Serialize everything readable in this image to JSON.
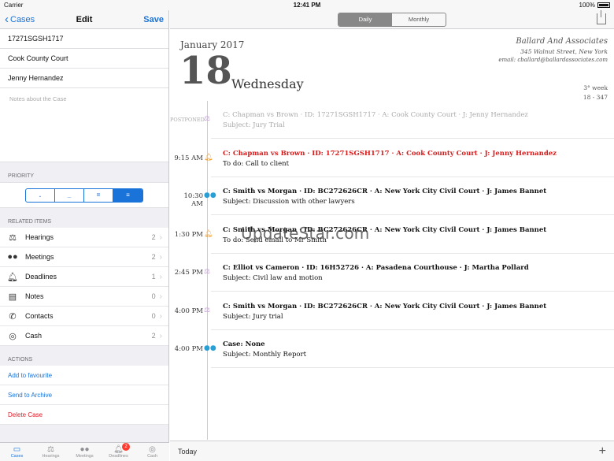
{
  "status": {
    "carrier": "Carrier",
    "time": "12:41 PM",
    "battery": "100%"
  },
  "left": {
    "back_label": "Cases",
    "title": "Edit",
    "save_label": "Save",
    "fields": [
      "17271SGSH1717",
      "Cook County Court",
      "Jenny Hernandez"
    ],
    "notes_placeholder": "Notes about the Case",
    "priority_header": "PRIORITY",
    "priority_levels": [
      ".",
      "_",
      "=",
      "≡"
    ],
    "related_header": "RELATED ITEMS",
    "related": [
      {
        "label": "Hearings",
        "count": "2",
        "icon": "scales-icon"
      },
      {
        "label": "Meetings",
        "count": "2",
        "icon": "binoculars-icon"
      },
      {
        "label": "Deadlines",
        "count": "1",
        "icon": "bell-icon"
      },
      {
        "label": "Notes",
        "count": "0",
        "icon": "notes-icon"
      },
      {
        "label": "Contacts",
        "count": "0",
        "icon": "phone-icon"
      },
      {
        "label": "Cash",
        "count": "2",
        "icon": "coins-icon"
      }
    ],
    "actions_header": "ACTIONS",
    "actions": [
      "Add to favourite",
      "Send to Archive",
      "Delete Case"
    ],
    "tabs": [
      {
        "label": "Cases",
        "icon": "folder-icon"
      },
      {
        "label": "Hearings",
        "icon": "scales-icon"
      },
      {
        "label": "Meetings",
        "icon": "binoculars-icon"
      },
      {
        "label": "Deadlines",
        "icon": "bell-icon",
        "badge": "2"
      },
      {
        "label": "Cash",
        "icon": "coins-icon"
      }
    ]
  },
  "right": {
    "view_daily": "Daily",
    "view_monthly": "Monthly",
    "month_year": "January 2017",
    "day_number": "18",
    "day_name": "Wednesday",
    "firm_name": "Ballard And Associates",
    "firm_address": "345 Walnut Street, New York",
    "firm_email": "email: cballard@ballardassociates.com",
    "week": "3° week",
    "day_of_year": "18 - 347",
    "events": [
      {
        "time": "POSTPONED",
        "line1": "C: Chapman vs Brown  ·  ID: 17271SGSH1717  ·  A: Cook County Court  ·  J: Jenny Hernandez",
        "line2": "Subject: Jury Trial",
        "icon": "scales-icon"
      },
      {
        "time": "9:15 AM",
        "line1": "C: Chapman vs Brown  ·  ID: 17271SGSH1717  ·  A: Cook County Court  ·  J: Jenny Hernandez",
        "line2": "To do: Call to client",
        "icon": "bell-icon"
      },
      {
        "time": "10:30 AM",
        "line1": "C: Smith vs Morgan  ·  ID: BC272626CR  ·  A: New York City Civil Court  ·  J: James Bannet",
        "line2": "Subject: Discussion with other lawyers",
        "icon": "binoculars-icon"
      },
      {
        "time": "1:30 PM",
        "line1": "C: Smith vs Morgan  ·  ID: BC272626CR  ·  A: New York City Civil Court  ·  J: James Bannet",
        "line2": "To do: Send email to Mr Smith",
        "icon": "bell-icon"
      },
      {
        "time": "2:45 PM",
        "line1": "C: Elliot vs Cameron  ·  ID: 16H52726  ·  A: Pasadena Courthouse  ·  J: Martha Pollard",
        "line2": "Subject: Civil law and motion",
        "icon": "scales-icon"
      },
      {
        "time": "4:00 PM",
        "line1": "C: Smith vs Morgan  ·  ID: BC272626CR  ·  A: New York City Civil Court  ·  J: James Bannet",
        "line2": "Subject: Jury trial",
        "icon": "scales-icon"
      },
      {
        "time": "4:00 PM",
        "line1": "Case: None",
        "line2": "Subject: Monthly Report",
        "icon": "binoculars-icon"
      }
    ],
    "watermark": "UpdateStar.com",
    "today_label": "Today",
    "add_label": "+"
  },
  "colors": {
    "accent": "#1a73d9",
    "danger": "#e0202a",
    "deadline": "#f0a030",
    "meeting": "#2a9fd6",
    "hearing": "#c8a0d8"
  }
}
